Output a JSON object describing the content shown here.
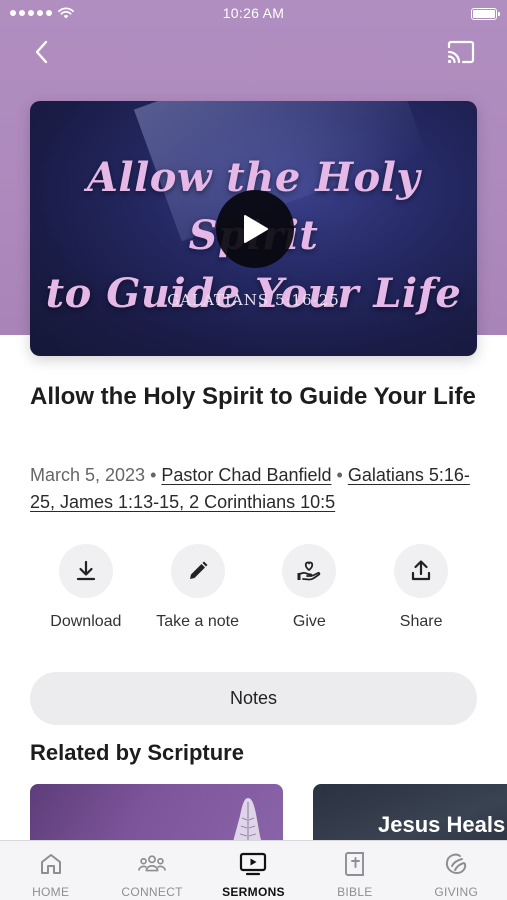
{
  "status_bar": {
    "time": "10:26 AM"
  },
  "video": {
    "title_line1": "Allow the Holy Spirit",
    "title_line2": "to Guide Your Life",
    "reference": "GALATIANS 5:16-25"
  },
  "sermon": {
    "title": "Allow the Holy Spirit to Guide Your Life",
    "date": "March 5, 2023",
    "separator": "•",
    "speaker": "Pastor Chad Banfield",
    "scriptures": "Galatians 5:16-25, James 1:13-15, 2 Corinthians 10:5"
  },
  "actions": [
    {
      "label": "Download",
      "icon": "download-icon"
    },
    {
      "label": "Take a note",
      "icon": "pencil-icon"
    },
    {
      "label": "Give",
      "icon": "give-hand-heart-icon"
    },
    {
      "label": "Share",
      "icon": "share-icon"
    }
  ],
  "notes_button": {
    "label": "Notes"
  },
  "related": {
    "title": "Related by Scripture",
    "items": [
      {
        "title": ""
      },
      {
        "title": "Jesus Heals"
      }
    ]
  },
  "tab_bar": {
    "active": "SERMONS",
    "items": [
      {
        "label": "HOME",
        "icon": "home-icon"
      },
      {
        "label": "CONNECT",
        "icon": "people-icon"
      },
      {
        "label": "SERMONS",
        "icon": "tv-play-icon"
      },
      {
        "label": "BIBLE",
        "icon": "bible-icon"
      },
      {
        "label": "GIVING",
        "icon": "giving-icon"
      }
    ]
  },
  "colors": {
    "header_bg": "#ad89bd",
    "video_bg": "#262a66",
    "title_text": "#e6b8e8",
    "accent_dark": "#111111"
  }
}
